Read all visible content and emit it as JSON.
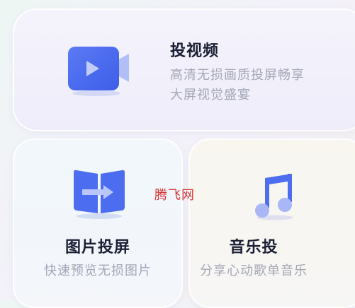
{
  "cards": {
    "video": {
      "title": "投视频",
      "subtitle_line1": "高清无损画质投屏畅享",
      "subtitle_line2": "大屏视觉盛宴"
    },
    "photo": {
      "title": "图片投屏",
      "subtitle": "快速预览无损图片"
    },
    "music": {
      "title": "音乐投",
      "subtitle": "分享心动歌单音乐"
    }
  },
  "watermark": "腾飞网",
  "icons": {
    "video": "video-camera-icon",
    "photo": "photo-cast-icon",
    "music": "music-note-icon"
  },
  "colors": {
    "accent": "#4e6ef0",
    "title_text": "#1b1f35",
    "subtitle_text": "#a3a6b6",
    "watermark": "#d63636"
  }
}
